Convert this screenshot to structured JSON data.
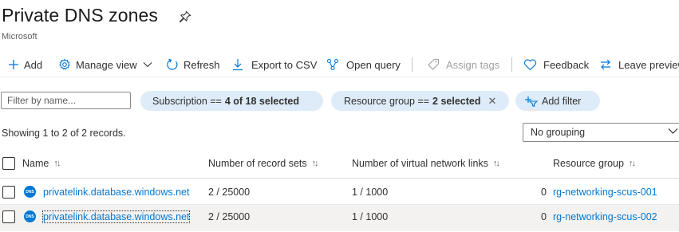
{
  "header": {
    "title": "Private DNS zones",
    "subtitle": "Microsoft"
  },
  "toolbar": {
    "add": "Add",
    "manage_view": "Manage view",
    "refresh": "Refresh",
    "export_csv": "Export to CSV",
    "open_query": "Open query",
    "assign_tags": "Assign tags",
    "feedback": "Feedback",
    "leave_preview": "Leave preview"
  },
  "filters": {
    "search_placeholder": "Filter by name...",
    "subscription": {
      "label": "Subscription ==",
      "value": "4 of 18 selected"
    },
    "resource_group": {
      "label": "Resource group ==",
      "value": "2 selected"
    },
    "add_filter": "Add filter"
  },
  "records_text": "Showing 1 to 2 of 2 records.",
  "grouping": {
    "selected": "No grouping"
  },
  "table": {
    "columns": [
      "Name",
      "Number of record sets",
      "Number of virtual network links",
      "Resource group"
    ],
    "sort_glyph": "↑↓",
    "rows": [
      {
        "icon_text": "DNS",
        "name": "privatelink.database.windows.net",
        "record_sets": "2 / 25000",
        "vnet_links": "1 / 1000",
        "prefix": "0",
        "resource_group": "rg-networking-scus-001"
      },
      {
        "icon_text": "DNS",
        "name": "privatelink.database.windows.net",
        "record_sets": "2 / 25000",
        "vnet_links": "1 / 1000",
        "prefix": "0",
        "resource_group": "rg-networking-scus-002"
      }
    ]
  },
  "colors": {
    "accent": "#0078d4",
    "pill_bg": "#deecf9",
    "selected_row": "#f3f2f1"
  }
}
